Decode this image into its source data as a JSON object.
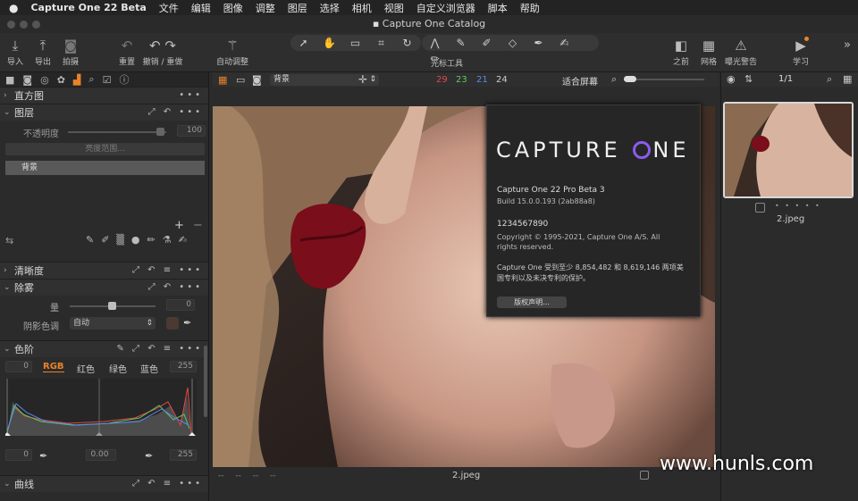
{
  "menubar": {
    "app": "Capture One 22 Beta",
    "items": [
      "文件",
      "编辑",
      "图像",
      "调整",
      "图层",
      "选择",
      "相机",
      "视图",
      "自定义浏览器",
      "脚本",
      "帮助"
    ]
  },
  "window": {
    "title": "Capture One Catalog"
  },
  "toolbar": {
    "import": "导入",
    "export": "导出",
    "capture": "拍摄",
    "reset": "重置",
    "undo_redo": "撤销 / 重做",
    "auto_adjust": "自动调整",
    "cursor_tools": "光标工具",
    "before": "之前",
    "grid": "网格",
    "exposure_warning": "曝光警告",
    "learn": "学习"
  },
  "left": {
    "histogram": "直方图",
    "layers": {
      "title": "图层",
      "opacity_label": "不透明度",
      "opacity_value": "100",
      "luma_range": "亮度范围...",
      "layer_name": "背景"
    },
    "clarity": "清晰度",
    "dehaze": {
      "title": "除雾",
      "amount_label": "量",
      "amount_value": "0",
      "shadow_label": "阴影色调",
      "shadow_value": "自动"
    },
    "levels": {
      "title": "色阶",
      "left_value": "0",
      "right_value": "255",
      "channels": [
        "RGB",
        "红色",
        "绿色",
        "蓝色"
      ],
      "bottom_left": "0",
      "bottom_mid": "0.00",
      "bottom_right": "255"
    },
    "curves": "曲线"
  },
  "viewer": {
    "layer_select": "背景",
    "count_red": "29",
    "count_green": "23",
    "count_blue": "21",
    "count_total": "24",
    "fit": "适合屏幕",
    "filename": "2.jpeg",
    "footer_dashes": [
      "--",
      "--",
      "--",
      "--"
    ]
  },
  "right": {
    "counter": "1/1",
    "thumb_name": "2.jpeg",
    "stars": "• • • • •"
  },
  "about": {
    "logo_text_1": "CAPTURE",
    "logo_text_2": "NE",
    "product": "Capture One 22 Pro  Beta 3",
    "build": "Build 15.0.0.193 (2ab88a8)",
    "serial": "1234567890",
    "copyright": "Copyright © 1995-2021, Capture One A/S. All rights reserved.",
    "patent": "Capture One 受到至少 8,854,482 和 8,619,146 两项美国专利以及未决专利的保护。",
    "license_button": "版权声明..."
  },
  "watermark": "www.hunls.com",
  "colors": {
    "accent": "#e8832a",
    "red": "#e04848",
    "green": "#5ec85e",
    "blue": "#5a8ae8"
  }
}
